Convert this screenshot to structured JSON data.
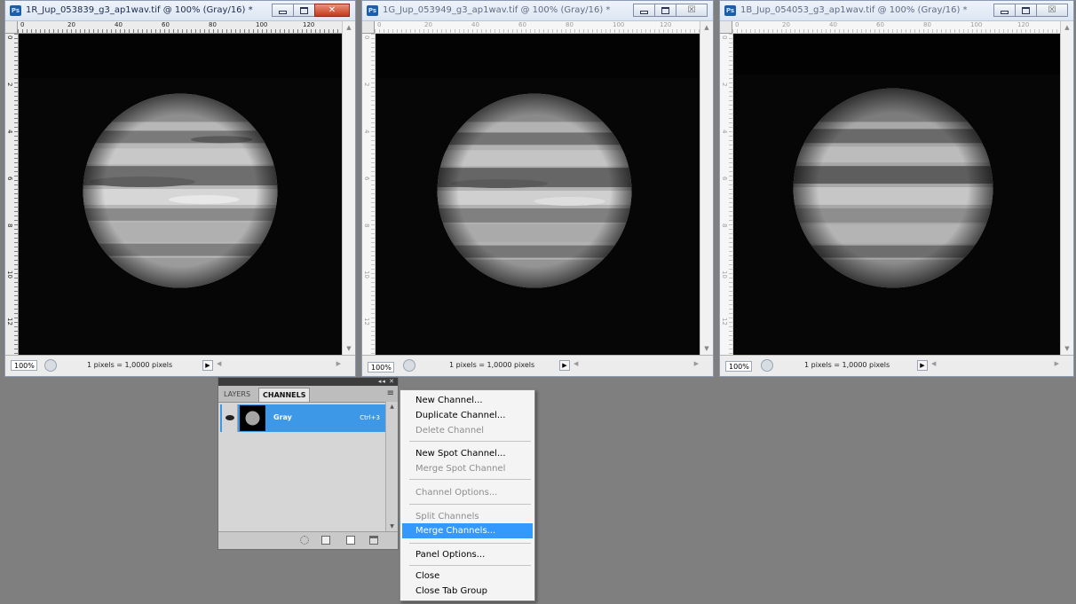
{
  "windows": [
    {
      "title": "1R_Jup_053839_g3_ap1wav.tif @ 100% (Gray/16) *",
      "active": true,
      "ruler_labels": [
        "0",
        "20",
        "40",
        "60",
        "80",
        "100",
        "120"
      ],
      "vruler_labels": [
        "0",
        "2",
        "4",
        "6",
        "8",
        "10",
        "12"
      ],
      "zoom": "100%",
      "status_info": "1 pixels = 1,0000 pixels",
      "close_glyph": "✕"
    },
    {
      "title": "1G_Jup_053949_g3_ap1wav.tif @ 100% (Gray/16) *",
      "active": false,
      "ruler_labels": [
        "0",
        "20",
        "40",
        "60",
        "80",
        "100",
        "120"
      ],
      "vruler_labels": [
        "0",
        "2",
        "4",
        "6",
        "8",
        "10",
        "12"
      ],
      "zoom": "100%",
      "status_info": "1 pixels = 1,0000 pixels",
      "close_glyph": "☒"
    },
    {
      "title": "1B_Jup_054053_g3_ap1wav.tif @ 100% (Gray/16) *",
      "active": false,
      "ruler_labels": [
        "0",
        "20",
        "40",
        "60",
        "80",
        "100",
        "120"
      ],
      "vruler_labels": [
        "0",
        "2",
        "4",
        "6",
        "8",
        "10",
        "12"
      ],
      "zoom": "100%",
      "status_info": "1 pixels = 1,0000 pixels",
      "close_glyph": "☒"
    }
  ],
  "panel": {
    "tabs": [
      "LAYERS",
      "CHANNELS"
    ],
    "active_tab": "CHANNELS",
    "panel_controls": "◂◂ ✕",
    "menu_glyph": "≡",
    "channel": {
      "name": "Gray",
      "shortcut": "Ctrl+3"
    }
  },
  "context_menu": {
    "items": [
      {
        "label": "New Channel...",
        "disabled": false,
        "highlighted": false
      },
      {
        "label": "Duplicate Channel...",
        "disabled": false,
        "highlighted": false
      },
      {
        "label": "Delete Channel",
        "disabled": true,
        "highlighted": false
      },
      {
        "separator": true
      },
      {
        "label": "New Spot Channel...",
        "disabled": false,
        "highlighted": false
      },
      {
        "label": "Merge Spot Channel",
        "disabled": true,
        "highlighted": false
      },
      {
        "separator": true
      },
      {
        "label": "Channel Options...",
        "disabled": true,
        "highlighted": false
      },
      {
        "separator": true
      },
      {
        "label": "Split Channels",
        "disabled": true,
        "highlighted": false
      },
      {
        "label": "Merge Channels...",
        "disabled": false,
        "highlighted": true
      },
      {
        "separator": true
      },
      {
        "label": "Panel Options...",
        "disabled": false,
        "highlighted": false
      },
      {
        "separator": true
      },
      {
        "label": "Close",
        "disabled": false,
        "highlighted": false
      },
      {
        "label": "Close Tab Group",
        "disabled": false,
        "highlighted": false
      }
    ]
  },
  "colors": {
    "workspace": "#7f7f7f",
    "highlight": "#3399ff",
    "channel_selected": "#3d98e8",
    "close_active": "#c4391c"
  }
}
